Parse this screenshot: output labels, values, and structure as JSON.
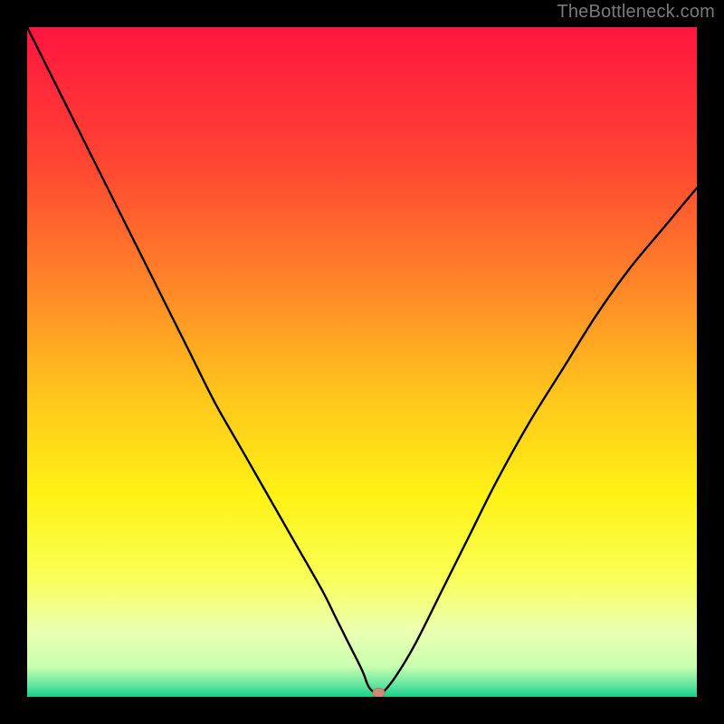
{
  "watermark": "TheBottleneck.com",
  "colors": {
    "frame": "#000000",
    "curve": "#000000",
    "marker_fill": "#cf8a77",
    "marker_stroke": "#b06a58",
    "watermark": "#7a7a7a"
  },
  "chart_data": {
    "type": "line",
    "title": "",
    "xlabel": "",
    "ylabel": "",
    "xlim": [
      0,
      100
    ],
    "ylim": [
      0,
      100
    ],
    "axes_visible": false,
    "grid": false,
    "background_gradient": {
      "stops": [
        {
          "offset": 0.0,
          "color": "#ff153f"
        },
        {
          "offset": 0.2,
          "color": "#ff4433"
        },
        {
          "offset": 0.4,
          "color": "#ff8b27"
        },
        {
          "offset": 0.55,
          "color": "#ffc61c"
        },
        {
          "offset": 0.7,
          "color": "#fff215"
        },
        {
          "offset": 0.82,
          "color": "#f9ff55"
        },
        {
          "offset": 0.9,
          "color": "#ecffb0"
        },
        {
          "offset": 0.955,
          "color": "#c9ffaf"
        },
        {
          "offset": 0.985,
          "color": "#58e29e"
        },
        {
          "offset": 1.0,
          "color": "#18cf87"
        }
      ]
    },
    "series": [
      {
        "name": "bottleneck-curve",
        "x": [
          0,
          4,
          8,
          12,
          16,
          20,
          24,
          28,
          32,
          36,
          40,
          44,
          46,
          48,
          50,
          51,
          52,
          53,
          55,
          58,
          62,
          66,
          70,
          75,
          80,
          85,
          90,
          95,
          100
        ],
        "y": [
          100,
          92,
          84,
          76,
          68,
          60,
          52,
          44,
          37,
          30,
          23,
          16,
          12,
          8,
          4,
          1.5,
          0.6,
          0.6,
          3,
          8,
          16,
          24,
          32,
          41,
          49,
          57,
          64,
          70,
          76
        ]
      }
    ],
    "marker": {
      "x": 52.5,
      "y": 0.6,
      "rx": 0.9,
      "ry": 0.7
    }
  }
}
